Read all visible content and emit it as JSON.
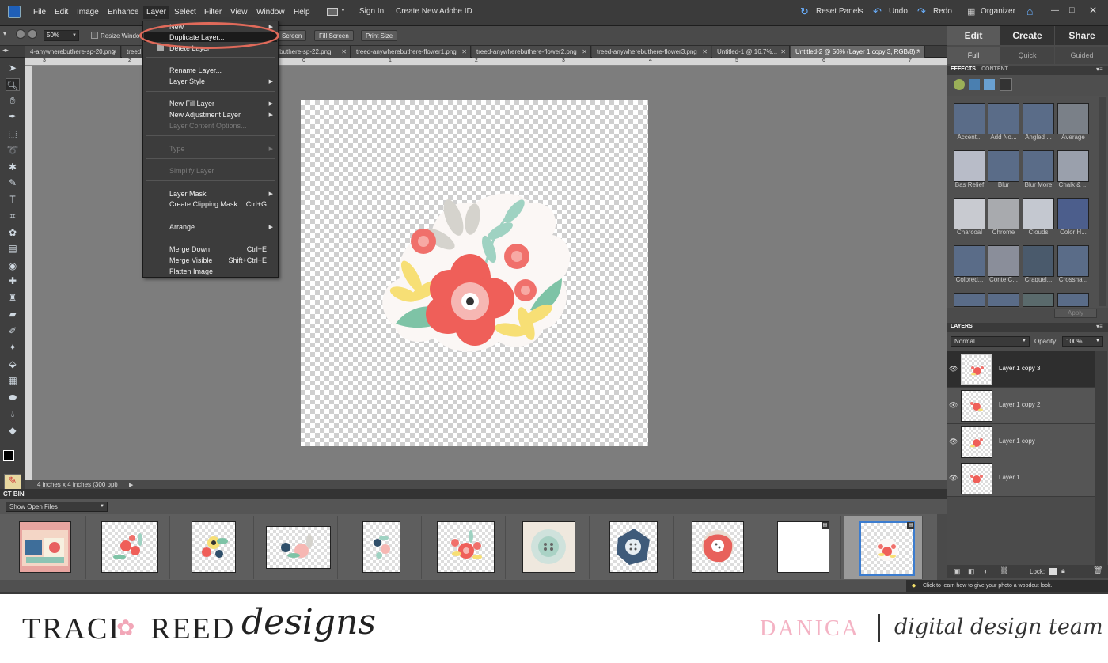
{
  "app": {
    "menus": [
      "File",
      "Edit",
      "Image",
      "Enhance",
      "Layer",
      "Select",
      "Filter",
      "View",
      "Window",
      "Help"
    ],
    "sign_in": "Sign In",
    "create_id": "Create New Adobe ID",
    "reset_panels": "Reset Panels",
    "undo": "Undo",
    "redo": "Redo",
    "organizer": "Organizer"
  },
  "options": {
    "zoom": "50%",
    "resize_windows": "Resize Windo",
    "btn_screen": "Screen",
    "btn_fill_screen": "Fill Screen",
    "btn_print_size": "Print Size"
  },
  "tabs": [
    "4-anywherebuthere-sp-20.png",
    "treed",
    "erbuthere-sp-22.png",
    "treed-anywherebuthere-flower1.png",
    "treed-anywherebuthere-flower2.png",
    "treed-anywherebuthere-flower3.png",
    "Untitled-1 @ 16.7%...",
    "Untitled-2 @ 50% (Layer 1 copy 3, RGB/8) *"
  ],
  "ruler_marks": [
    "3",
    "2",
    "1",
    "0",
    "1",
    "2",
    "3",
    "4",
    "5",
    "6",
    "7"
  ],
  "status": "4 inches x 4 inches (300 ppi)",
  "project_bin": {
    "title": "CT BIN",
    "show": "Show Open Files"
  },
  "layer_menu": {
    "new": "New",
    "duplicate": "Duplicate Layer...",
    "delete": "Delete Layer",
    "rename": "Rename Layer...",
    "style": "Layer Style",
    "new_fill": "New Fill Layer",
    "new_adjust": "New Adjustment Layer",
    "content_opts": "Layer Content Options...",
    "type": "Type",
    "simplify": "Simplify Layer",
    "mask": "Layer Mask",
    "clipping": "Create Clipping Mask",
    "clipping_key": "Ctrl+G",
    "arrange": "Arrange",
    "merge_down": "Merge Down",
    "merge_down_key": "Ctrl+E",
    "merge_visible": "Merge Visible",
    "merge_visible_key": "Shift+Ctrl+E",
    "flatten": "Flatten Image"
  },
  "panel": {
    "tabs": [
      "Edit",
      "Create",
      "Share"
    ],
    "subtabs": [
      "Full",
      "Quick",
      "Guided"
    ],
    "effects_tab": "EFFECTS",
    "content_tab": "CONTENT",
    "effects": [
      "Accent...",
      "Add No...",
      "Angled ...",
      "Average",
      "Bas Relief",
      "Blur",
      "Blur More",
      "Chalk & ...",
      "Charcoal",
      "Chrome",
      "Clouds",
      "Color H...",
      "Colored...",
      "Conte C...",
      "Craquel...",
      "Crossha..."
    ],
    "apply": "Apply",
    "layers_title": "LAYERS",
    "blend_mode": "Normal",
    "opacity_label": "Opacity:",
    "opacity": "100%",
    "lock_label": "Lock:",
    "layers": [
      "Layer 1 copy 3",
      "Layer 1 copy 2",
      "Layer 1 copy",
      "Layer 1"
    ],
    "hint": "Click to learn how to give your photo a woodcut look."
  },
  "footer": {
    "brand": "TRACI",
    "brand2": "REED",
    "brand_script": "designs",
    "member": "DANICA",
    "team": "digital design team"
  }
}
